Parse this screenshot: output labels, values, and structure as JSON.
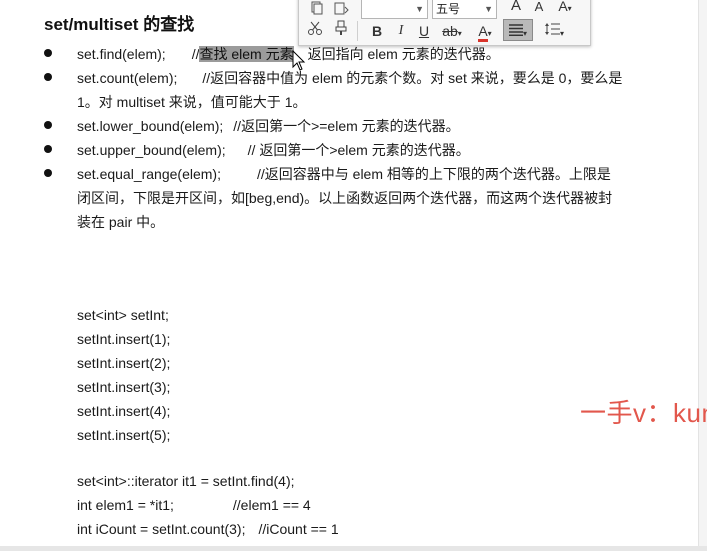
{
  "page_title": "set/multiset 的查找",
  "bullets": [
    {
      "line1_code": "set.find(elem);",
      "line1_comment": "//查找 elem 元素，返回指向 elem 元素的迭代器。",
      "selected_text": "查找 elem 元素",
      "comment_before": "//",
      "comment_after": "，返回指向 elem 元素的迭代器。"
    },
    {
      "line1_code": "set.count(elem);",
      "line1_comment": "//返回容器中值为 elem 的元素个数。对 set 来说，要么是 0，要么是",
      "line2": "1。对 multiset 来说，值可能大于 1。"
    },
    {
      "line1_code": "set.lower_bound(elem);",
      "line1_comment": "//返回第一个>=elem 元素的迭代器。"
    },
    {
      "line1_code": "set.upper_bound(elem);",
      "line1_comment": "//   返回第一个>elem 元素的迭代器。"
    },
    {
      "line1_code": "set.equal_range(elem);",
      "line1_comment": "//返回容器中与 elem 相等的上下限的两个迭代器。上限是",
      "line2": "闭区间，下限是开区间，如[beg,end)。以上函数返回两个迭代器，而这两个迭代器被封",
      "line3": "装在 pair 中。"
    }
  ],
  "code_lines": [
    "set<int> setInt;",
    "setInt.insert(1);",
    "setInt.insert(2);",
    "setInt.insert(3);",
    "setInt.insert(4);",
    "setInt.insert(5);",
    "",
    "set<int>::iterator it1 = setInt.find(4);",
    "int elem1 = *it1;",
    "int iCount = setInt.count(3);"
  ],
  "code_comments": {
    "elem1": "//elem1 == 4",
    "icount": "//iCount == 1"
  },
  "watermark": "一手v：kunl",
  "toolbar": {
    "font_size_value": "五号",
    "bold": "B",
    "italic": "I",
    "underline": "U",
    "strike": "ab",
    "font_color": "A",
    "grow_font": "A",
    "shrink_font": "A",
    "clear_format": "A"
  },
  "colors": {
    "selection": "#9b9b9b",
    "watermark": "#e2574c",
    "font_color_bar": "#d9342b"
  }
}
